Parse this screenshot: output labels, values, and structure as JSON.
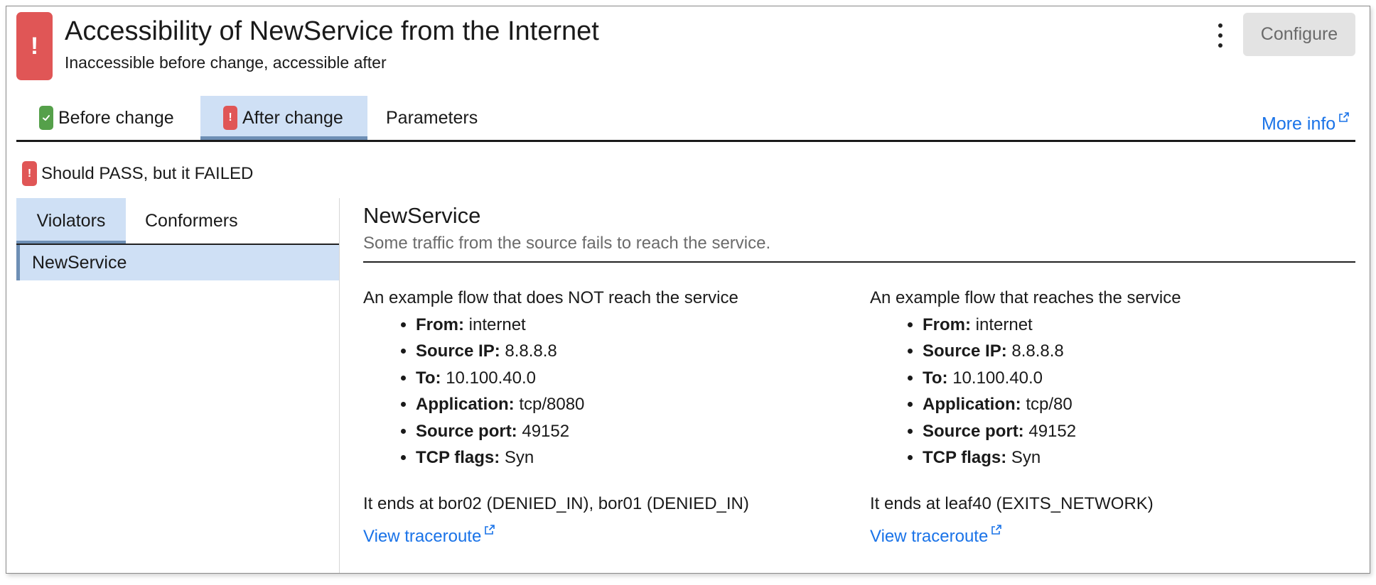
{
  "header": {
    "title": "Accessibility of NewService from the Internet",
    "subtitle": "Inaccessible before change, accessible after",
    "status_icon": "!",
    "configure_label": "Configure"
  },
  "tabs": [
    {
      "label": "Before change",
      "icon": "check-icon",
      "icon_color": "#55a04a",
      "active": false
    },
    {
      "label": "After change",
      "icon": "!",
      "icon_color": "#e05656",
      "active": true
    },
    {
      "label": "Parameters",
      "active": false
    }
  ],
  "more_info": "More info",
  "status": {
    "icon": "!",
    "text": "Should PASS, but it FAILED"
  },
  "result_tabs": [
    {
      "label": "Violators",
      "active": true
    },
    {
      "label": "Conformers",
      "active": false
    }
  ],
  "violators": [
    "NewService"
  ],
  "detail": {
    "title": "NewService",
    "description": "Some traffic from the source fails to reach the service.",
    "flows": [
      {
        "heading": "An example flow that does NOT reach the service",
        "fields": [
          {
            "label": "From:",
            "value": "internet"
          },
          {
            "label": "Source IP:",
            "value": "8.8.8.8"
          },
          {
            "label": "To:",
            "value": "10.100.40.0"
          },
          {
            "label": "Application:",
            "value": "tcp/8080"
          },
          {
            "label": "Source port:",
            "value": "49152"
          },
          {
            "label": "TCP flags:",
            "value": "Syn"
          }
        ],
        "ends": "It ends at bor02 (DENIED_IN), bor01 (DENIED_IN)",
        "traceroute": "View traceroute"
      },
      {
        "heading": "An example flow that reaches the service",
        "fields": [
          {
            "label": "From:",
            "value": "internet"
          },
          {
            "label": "Source IP:",
            "value": "8.8.8.8"
          },
          {
            "label": "To:",
            "value": "10.100.40.0"
          },
          {
            "label": "Application:",
            "value": "tcp/80"
          },
          {
            "label": "Source port:",
            "value": "49152"
          },
          {
            "label": "TCP flags:",
            "value": "Syn"
          }
        ],
        "ends": "It ends at leaf40 (EXITS_NETWORK)",
        "traceroute": "View traceroute"
      }
    ]
  },
  "colors": {
    "error": "#e05656",
    "success": "#55a04a",
    "link": "#1a73e8",
    "selected_bg": "#cfe0f5",
    "selected_accent": "#6e8fb5"
  }
}
